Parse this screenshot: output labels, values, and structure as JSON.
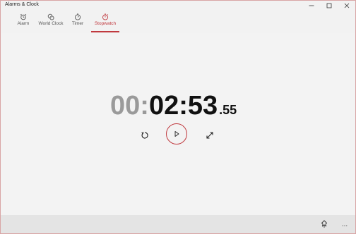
{
  "window": {
    "title": "Alarms & Clock"
  },
  "tabs": [
    {
      "label": "Alarm",
      "icon": "alarm-clock-icon"
    },
    {
      "label": "World Clock",
      "icon": "world-clock-icon"
    },
    {
      "label": "Timer",
      "icon": "timer-icon"
    },
    {
      "label": "Stopwatch",
      "icon": "stopwatch-icon",
      "selected": true
    }
  ],
  "stopwatch": {
    "hours": "00",
    "separator_1": ":",
    "minutes": "02",
    "separator_2": ":",
    "seconds": "53",
    "fraction": ".55",
    "state": "paused"
  },
  "controls": {
    "reset": "reset-icon",
    "play": "play-icon",
    "expand": "expand-icon"
  },
  "bottom_bar": {
    "share": "pin-icon",
    "more": "..."
  },
  "colors": {
    "accent": "#c0393e",
    "hours_dim": "#9a9a9a",
    "time_text": "#111111",
    "background": "#f3f3f3",
    "bottom_bar": "#e4e4e4"
  }
}
